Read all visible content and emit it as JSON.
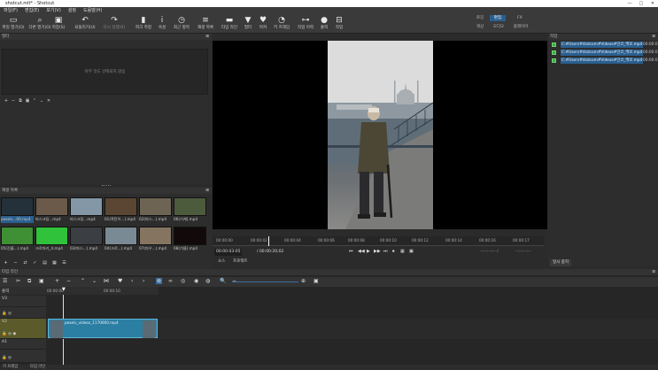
{
  "window": {
    "title": "shotcut.mlt* - Shotcut",
    "controls": [
      "—",
      "□",
      "✕"
    ]
  },
  "menu": [
    "파일(F)",
    "편집(E)",
    "보기(V)",
    "설정",
    "도움말(H)"
  ],
  "toolbar": [
    {
      "icon": "open-folder-icon",
      "glyph": "▭",
      "label": "파일 열기(O)"
    },
    {
      "icon": "other-icon",
      "glyph": "⌕",
      "label": "다른 열기(O)"
    },
    {
      "icon": "save-icon",
      "glyph": "▣",
      "label": "저장(S)"
    },
    {
      "icon": "undo-icon",
      "glyph": "↶",
      "label": "되돌리기(U)"
    },
    {
      "icon": "redo-icon",
      "glyph": "↷",
      "label": "다시 실행(R)"
    },
    {
      "icon": "peak-meter-icon",
      "glyph": "▮",
      "label": "피크 측정"
    },
    {
      "icon": "properties-icon",
      "glyph": "i",
      "label": "속성"
    },
    {
      "icon": "recent-icon",
      "glyph": "◷",
      "label": "최근 항목"
    },
    {
      "icon": "playlist-icon",
      "glyph": "≡",
      "label": "재생 목록"
    },
    {
      "icon": "timeline-icon",
      "glyph": "▬",
      "label": "타임 라인"
    },
    {
      "icon": "filter-icon",
      "glyph": "▼",
      "label": "필터"
    },
    {
      "icon": "markers-icon",
      "glyph": "♥",
      "label": "마커"
    },
    {
      "icon": "keyframes-icon",
      "glyph": "◔",
      "label": "키 프레임"
    },
    {
      "icon": "history-icon",
      "glyph": "⊶",
      "label": "작업 이력"
    },
    {
      "icon": "export-icon",
      "glyph": "●",
      "label": "출력"
    },
    {
      "icon": "jobs-icon",
      "glyph": "⊟",
      "label": "작업"
    }
  ],
  "layouts": {
    "row1": [
      "로깅",
      "편집",
      "FX"
    ],
    "row2": [
      "색상",
      "오디오",
      "플레이어"
    ]
  },
  "filters_panel": {
    "title": "필터",
    "empty_text": "아무 것도 선택되지 않음",
    "tools": [
      "+",
      "−",
      "⧉",
      "▣",
      "⌃",
      "⌄",
      "✕"
    ]
  },
  "playlist_panel": {
    "title": "재생 목록",
    "items": [
      {
        "caption": "pexels...00.mp4",
        "color": "#24313a",
        "selected": true
      },
      {
        "caption": "마스크팅...mp4",
        "color": "#6b5a4a",
        "selected": false
      },
      {
        "caption": "마스크팅...mp4",
        "color": "#8497a6",
        "selected": false
      },
      {
        "caption": "01(폭탄이...).mp4",
        "color": "#5a4633",
        "selected": false
      },
      {
        "caption": "02(마스...).mp4",
        "color": "#6d6453",
        "selected": false
      },
      {
        "caption": "06(기계).mp4",
        "color": "#4d5b3d",
        "selected": false
      },
      {
        "caption": "05(진흙...).mp4",
        "color": "#3f8f34",
        "selected": false
      },
      {
        "caption": "크로마키_4.mp4",
        "color": "#2fc23a",
        "selected": false
      },
      {
        "caption": "03(마스...).mp4",
        "color": "#3b3f44",
        "selected": false
      },
      {
        "caption": "04(크로...).mp4",
        "color": "#7a8a94",
        "selected": false
      },
      {
        "caption": "07(마우...).mp4",
        "color": "#857560",
        "selected": false
      },
      {
        "caption": "08(기름).mp4",
        "color": "#120a0a",
        "selected": false
      }
    ],
    "tools": [
      "+",
      "−",
      "⇄",
      "✓",
      "▤",
      "▦",
      "☰"
    ]
  },
  "viewer": {
    "ruler_ticks": [
      "00:00:00",
      "00:00:02",
      "00:00:04",
      "00:00:06",
      "00:00:08",
      "00:00:10",
      "00:00:12",
      "00:00:14",
      "00:00:16",
      "00:00:17"
    ],
    "timecode_current": "00:00:03:05",
    "timecode_total": "/ 00:00:20;02",
    "transport": [
      "⏮",
      "◀◀",
      "▶",
      "▶▶",
      "⏭",
      "⏹",
      "▦",
      "▣"
    ],
    "in_point": "--:--:--:-- /",
    "out_point": "--:--:--:--",
    "tabs": [
      "소스",
      "프로젝트"
    ]
  },
  "history_panel": {
    "title": "작업",
    "rows": [
      {
        "path": "C:#Users#Vodcom#Videos#인코_백로.mp4",
        "time": "00:00:0"
      },
      {
        "path": "C:#Users#Vodcom#Videos#인코_백로.mp4",
        "time": "00:00:0"
      },
      {
        "path": "C:#Users#Vodcom#Videos#인코_백로.mp4",
        "time": "00:00:0"
      }
    ],
    "button": "일시 중지"
  },
  "timeline_panel": {
    "title": "타임 라인",
    "tools": [
      "☰",
      "✂",
      "⧉",
      "▣",
      "+",
      "−",
      "⌃",
      "⌄",
      "⋈",
      "♥",
      "‹",
      "›",
      "⊗",
      "∞",
      "◎",
      "◉",
      "◍",
      "🔍",
      "−",
      "⊕",
      "▣"
    ],
    "header_label": "출력",
    "ruler": [
      "00:00:00",
      "00:00:10"
    ],
    "tracks": [
      {
        "name": "V3",
        "icons": "🔒 ◎"
      },
      {
        "name": "V2",
        "icons": "🔒 ◎"
      },
      {
        "name": "V1",
        "icons": "🔒 ◎ ◉"
      },
      {
        "name": "A1",
        "icons": "🔒 ◎"
      }
    ],
    "clip_name": "pexels_videos_1170000.mp4"
  },
  "status_tabs": [
    "키 프레임",
    "타임 라인"
  ]
}
